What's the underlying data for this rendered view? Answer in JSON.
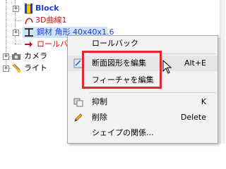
{
  "tree": {
    "items": [
      {
        "label": "Block",
        "color": "#1a3fd6"
      },
      {
        "label": "3D曲線1",
        "color": "#d01010"
      },
      {
        "label": "鋼材 角形 40x40x1.6",
        "color": "#1a3fd6"
      },
      {
        "label": "ロールバッ",
        "color": "#d01010"
      },
      {
        "label": "カメラ"
      },
      {
        "label": "ライト"
      }
    ],
    "selection_color": "#cfe3f7"
  },
  "context_menu": {
    "items": [
      {
        "label": "ロールバック",
        "shortcut": ""
      },
      {
        "label": "断面図形を編集",
        "shortcut": "Alt+E"
      },
      {
        "label": "フィーチャを編集",
        "shortcut": ""
      },
      {
        "label": "抑制",
        "shortcut": "K"
      },
      {
        "label": "削除",
        "shortcut": "Delete"
      },
      {
        "label": "シェイプの関係...",
        "shortcut": ""
      }
    ],
    "highlight_color": "#e3262f"
  }
}
